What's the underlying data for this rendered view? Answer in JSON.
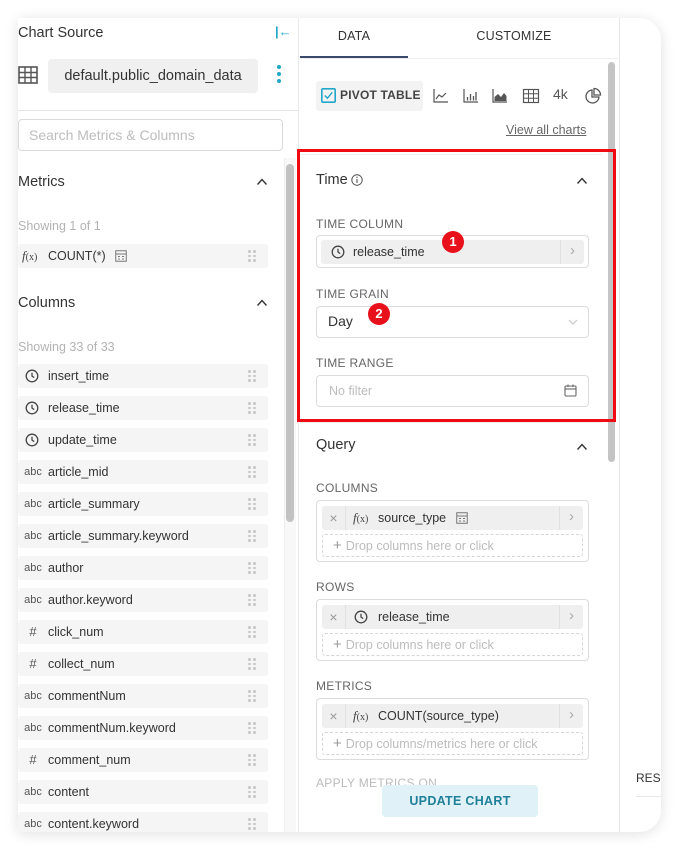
{
  "left_panel": {
    "title": "Chart Source",
    "collapse_icon": "collapse-left-icon",
    "datasource": {
      "icon": "table-grid-icon",
      "name": "default.public_domain_data",
      "more_icon": "vertical-ellipsis-icon"
    },
    "search": {
      "placeholder": "Search Metrics & Columns",
      "value": ""
    },
    "metrics": {
      "title": "Metrics",
      "showing": "Showing 1 of 1",
      "items": [
        {
          "type": "f(x)",
          "label": "COUNT(*)",
          "has_calc_icon": true
        }
      ]
    },
    "columns": {
      "title": "Columns",
      "showing": "Showing 33 of 33",
      "items": [
        {
          "type": "time",
          "label": "insert_time"
        },
        {
          "type": "time",
          "label": "release_time"
        },
        {
          "type": "time",
          "label": "update_time"
        },
        {
          "type": "abc",
          "label": "article_mid"
        },
        {
          "type": "abc",
          "label": "article_summary"
        },
        {
          "type": "abc",
          "label": "article_summary.keyword"
        },
        {
          "type": "abc",
          "label": "author"
        },
        {
          "type": "abc",
          "label": "author.keyword"
        },
        {
          "type": "#",
          "label": "click_num"
        },
        {
          "type": "#",
          "label": "collect_num"
        },
        {
          "type": "abc",
          "label": "commentNum"
        },
        {
          "type": "abc",
          "label": "commentNum.keyword"
        },
        {
          "type": "#",
          "label": "comment_num"
        },
        {
          "type": "abc",
          "label": "content"
        },
        {
          "type": "abc",
          "label": "content.keyword"
        }
      ]
    }
  },
  "middle_panel": {
    "tabs": [
      {
        "label": "DATA",
        "active": true
      },
      {
        "label": "CUSTOMIZE",
        "active": false
      }
    ],
    "chart_types": {
      "selected": "PIVOT TABLE",
      "icons": [
        "line-chart-icon",
        "bar-chart-icon",
        "area-chart-icon",
        "table-icon",
        "big-number-icon",
        "pie-chart-icon"
      ],
      "big_number_label": "4k",
      "view_all": "View all charts"
    },
    "time_section": {
      "title": "Time",
      "time_column": {
        "label": "TIME COLUMN",
        "value": "release_time"
      },
      "time_grain": {
        "label": "TIME GRAIN",
        "value": "Day"
      },
      "time_range": {
        "label": "TIME RANGE",
        "placeholder": "No filter"
      }
    },
    "query_section": {
      "title": "Query",
      "columns": {
        "label": "COLUMNS",
        "value": "source_type",
        "drop_hint": "Drop columns here or click"
      },
      "rows": {
        "label": "ROWS",
        "value": "release_time",
        "drop_hint": "Drop columns here or click"
      },
      "metrics": {
        "label": "METRICS",
        "value": "COUNT(source_type)",
        "drop_hint": "Drop columns/metrics here or click"
      },
      "apply_metrics_label": "APPLY METRICS ON"
    },
    "update_button": "UPDATE CHART"
  },
  "right_panel": {
    "results_tab": "RESULTS"
  },
  "annotations": {
    "badges": [
      "1",
      "2"
    ],
    "highlight_color": "#ee0a10"
  },
  "colors": {
    "accent": "#20a7c9",
    "badge": "#e8101a",
    "tab_underline": "#3b4a6b"
  }
}
